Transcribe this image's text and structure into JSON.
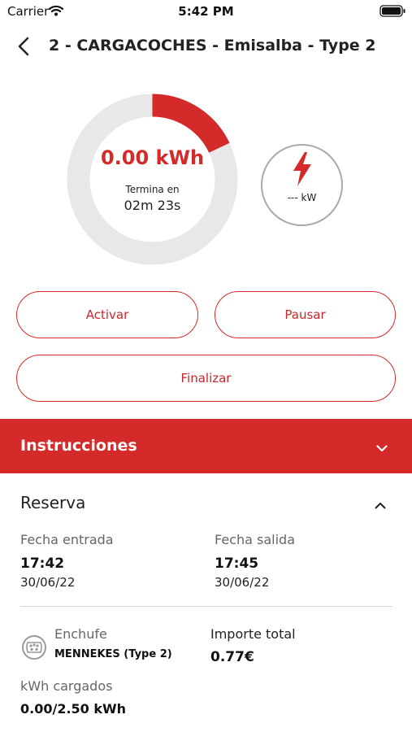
{
  "status_bar": {
    "carrier": "Carrier",
    "time": "5:42 PM"
  },
  "nav": {
    "title": "2 - CARGACOCHES - Emisalba - Type 2"
  },
  "charge": {
    "energy": "0.00 kWh",
    "ends_label": "Termina en",
    "ends_value": "02m 23s",
    "progress_fraction": 0.18,
    "power": "--- kW"
  },
  "actions": {
    "activate": "Activar",
    "pause": "Pausar",
    "finish": "Finalizar"
  },
  "instructions": {
    "label": "Instrucciones"
  },
  "reservation": {
    "title": "Reserva",
    "entry_label": "Fecha entrada",
    "entry_time": "17:42",
    "entry_date": "30/06/22",
    "exit_label": "Fecha salida",
    "exit_time": "17:45",
    "exit_date": "30/06/22",
    "plug_label": "Enchufe",
    "plug_type": "MENNEKES (Type 2)",
    "total_label": "Importe total",
    "total_value": "0.77€",
    "kwh_label": "kWh cargados",
    "kwh_value": "0.00/2.50 kWh"
  },
  "colors": {
    "accent": "#d42a2a",
    "ring_track": "#e8e8e8"
  },
  "icons": [
    "wifi-icon",
    "battery-icon",
    "back-arrow-icon",
    "lightning-bolt-icon",
    "chevron-down-icon",
    "chevron-up-icon",
    "plug-icon"
  ]
}
